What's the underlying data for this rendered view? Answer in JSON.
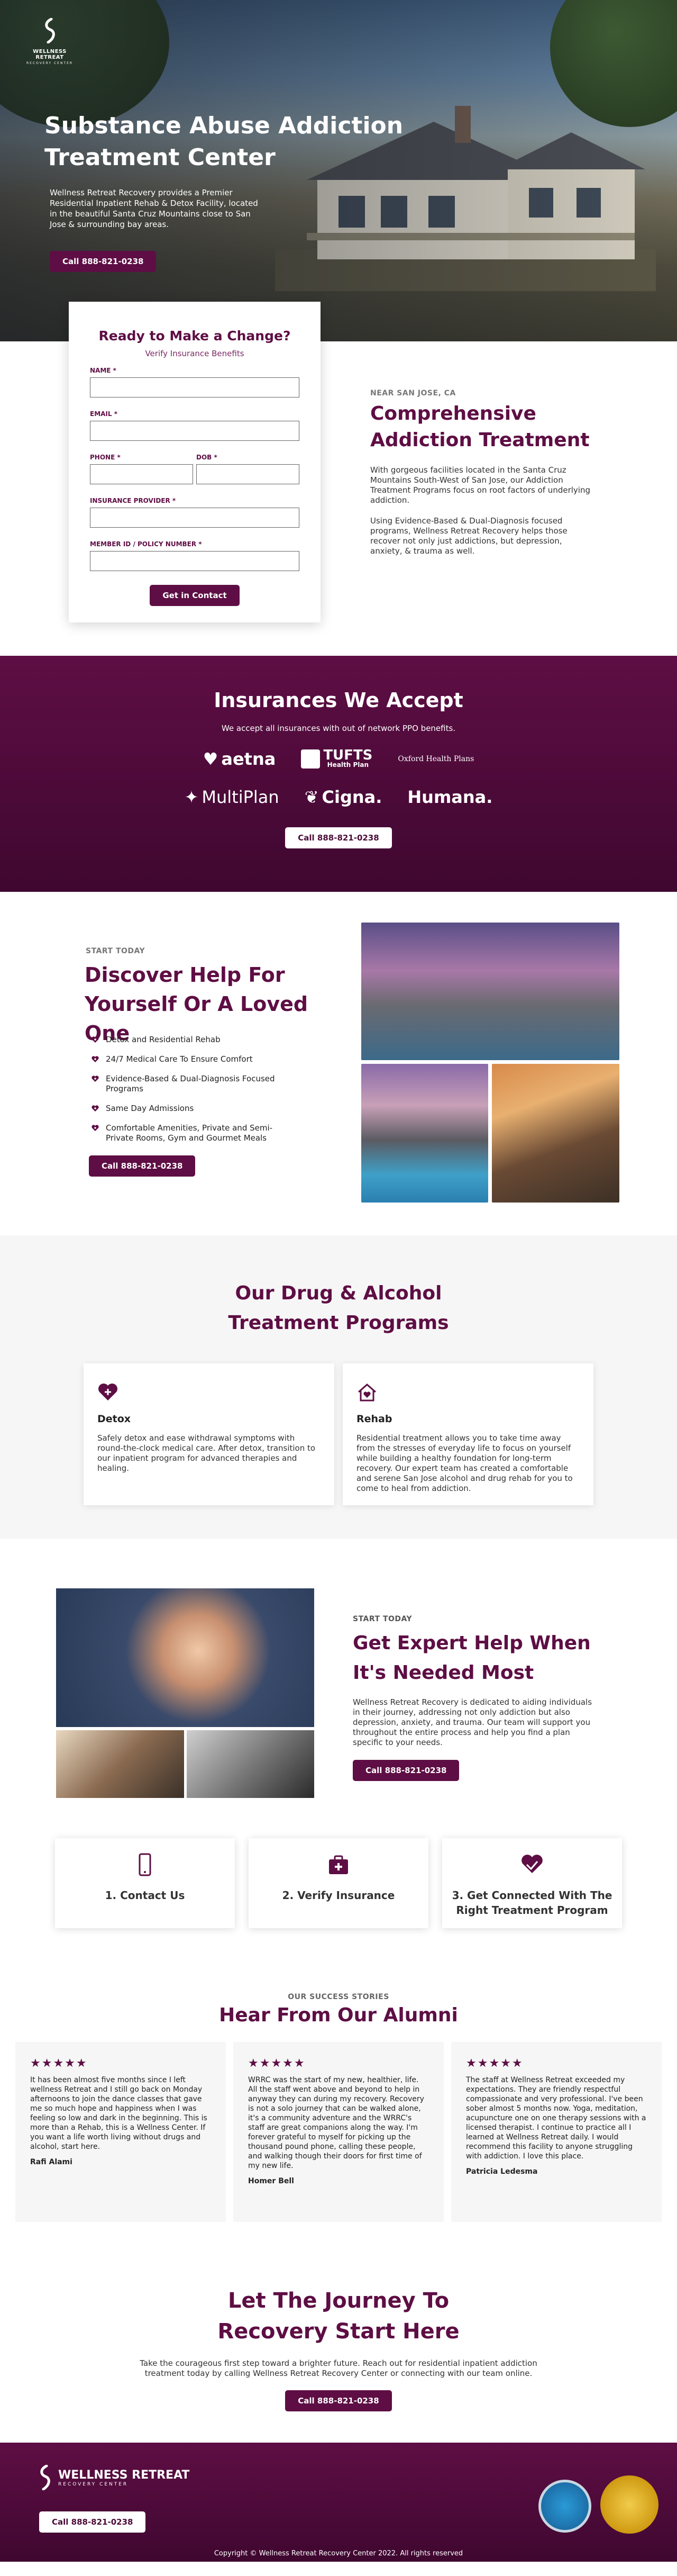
{
  "brand": {
    "name": "WELLNESS RETREAT",
    "sub": "RECOVERY CENTER",
    "colors": {
      "primary": "#5e0e44",
      "primary_dark": "#3f0730"
    }
  },
  "hero": {
    "title": "Substance Abuse Addiction Treatment Center",
    "lead": "Wellness Retreat Recovery provides a Premier Residential Inpatient Rehab & Detox Facility, located in the beautiful Santa Cruz Mountains close to San Jose & surrounding bay areas.",
    "cta": "Call 888-821-0238"
  },
  "form": {
    "title": "Ready to Make a Change?",
    "subtitle": "Verify Insurance Benefits",
    "name_label": "NAME *",
    "email_label": "EMAIL *",
    "phone_label": "PHONE *",
    "dob_label": "DOB *",
    "provider_label": "INSURANCE PROVIDER *",
    "member_label": "MEMBER ID / POLICY NUMBER *",
    "submit": "Get in Contact"
  },
  "intro": {
    "eyebrow": "NEAR SAN JOSE, CA",
    "title": "Comprehensive Addiction Treatment",
    "p1": "With gorgeous facilities located in the Santa Cruz Mountains South-West of San Jose, our Addiction Treatment Programs focus on root factors of underlying addiction.",
    "p2": "Using Evidence-Based & Dual-Diagnosis focused programs, Wellness Retreat Recovery helps those recover not only just addictions, but depression, anxiety, & trauma as well."
  },
  "insurance": {
    "title": "Insurances We Accept",
    "text": "We accept all insurances with out of network PPO benefits.",
    "logos": [
      "aetna",
      "TUFTS",
      "Health Plan",
      "Oxford Health Plans",
      "MultiPlan",
      "Cigna.",
      "Humana."
    ],
    "cta": "Call 888-821-0238"
  },
  "discover": {
    "eyebrow": "START TODAY",
    "title": "Discover Help For Yourself Or A Loved One",
    "items": [
      "Detox and Residential Rehab",
      "24/7 Medical Care To Ensure Comfort",
      "Evidence-Based & Dual-Diagnosis Focused Programs",
      "Same Day Admissions",
      "Comfortable Amenities, Private and Semi-Private Rooms, Gym and Gourmet Meals"
    ],
    "cta": "Call 888-821-0238"
  },
  "programs": {
    "title": "Our Drug & Alcohol Treatment Programs",
    "cards": [
      {
        "icon": "heart-plus-icon",
        "title": "Detox",
        "text": "Safely detox and ease withdrawal symptoms with round-the-clock medical care. After detox, transition to our inpatient program for advanced therapies and healing."
      },
      {
        "icon": "house-heart-icon",
        "title": "Rehab",
        "text": "Residential treatment allows you to take time away from the stresses of everyday life to focus on yourself while building a healthy foundation for long-term recovery. Our expert team has created a comfortable and serene San Jose alcohol and drug rehab for you to come to heal from addiction."
      }
    ]
  },
  "expert": {
    "eyebrow": "START TODAY",
    "title": "Get Expert Help When It's Needed Most",
    "text": "Wellness Retreat Recovery is dedicated to aiding individuals in their journey, addressing not only addiction but also depression, anxiety, and trauma. Our team will support you throughout the entire process and help you find a plan specific to your needs.",
    "cta": "Call 888-821-0238"
  },
  "steps": [
    {
      "icon": "phone-icon",
      "label": "1. Contact Us"
    },
    {
      "icon": "medical-kit-icon",
      "label": "2. Verify Insurance"
    },
    {
      "icon": "heart-hands-icon",
      "label": "3. Get Connected With The Right Treatment Program"
    }
  ],
  "testimonials": {
    "eyebrow": "OUR SUCCESS STORIES",
    "title": "Hear From Our Alumni",
    "stars": "★★★★★",
    "items": [
      {
        "text": "It has been almost five months since I left wellness Retreat and I still go back on Monday afternoons to join the dance classes that gave me so much hope and happiness when I was feeling so low and dark in the beginning. This is more than a Rehab, this is a Wellness Center. If you want a life worth living without drugs and alcohol, start here.",
        "name": "Rafi Alami"
      },
      {
        "text": "WRRC was the start of my new, healthier, life. All the staff went above and beyond to help in anyway they can during my recovery. Recovery is not a solo journey that can be walked alone, it's a community adventure and the WRRC's staff are great companions along the way. I'm forever grateful to myself for picking up the thousand pound phone, calling these people, and walking though their doors for first time of my new life.",
        "name": "Homer Bell"
      },
      {
        "text": "The staff at Wellness Retreat exceeded my expectations. They are friendly respectful compassionate and very professional.  I've been sober almost 5 months now. Yoga, meditation, acupuncture one on one therapy sessions with a licensed therapist. I continue to practice all I learned at Wellness Retreat daily. I would recommend this facility to anyone struggling with addiction. I love this place.",
        "name": "Patricia Ledesma"
      }
    ]
  },
  "cta": {
    "title": "Let The Journey To Recovery Start Here",
    "text": "Take the courageous first step toward a brighter future. Reach out for residential inpatient addiction treatment today by calling Wellness Retreat Recovery Center or connecting with our team online.",
    "button": "Call 888-821-0238"
  },
  "footer": {
    "cta": "Call 888-821-0238",
    "copyright": "Copyright © Wellness Retreat Recovery Center 2022. All rights reserved"
  }
}
